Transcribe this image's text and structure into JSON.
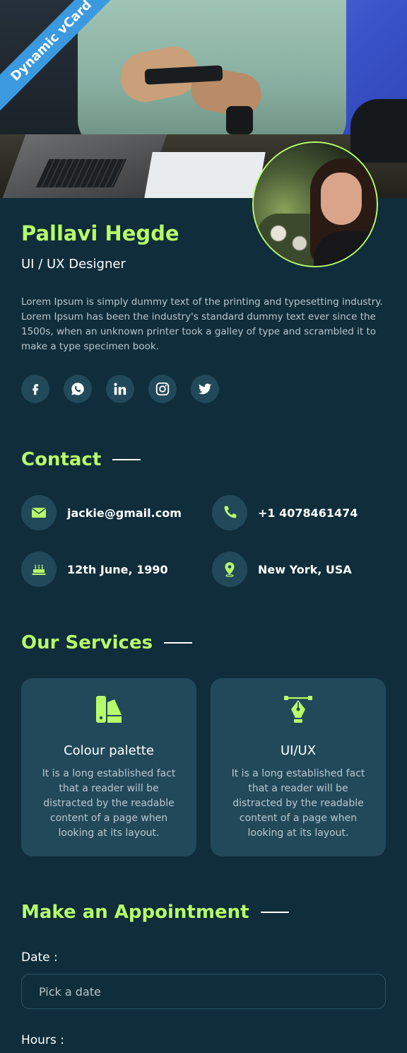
{
  "ribbon": {
    "label": "Dynamic vCard"
  },
  "profile": {
    "name": "Pallavi Hegde",
    "role": "UI / UX Designer",
    "about": "Lorem Ipsum is simply dummy text of the printing and typesetting industry. Lorem Ipsum has been the industry's standard dummy text ever since the 1500s, when an unknown printer took a galley of type and scrambled it to make a type specimen book."
  },
  "socials": [
    {
      "icon": "facebook-icon"
    },
    {
      "icon": "whatsapp-icon"
    },
    {
      "icon": "linkedin-icon"
    },
    {
      "icon": "instagram-icon"
    },
    {
      "icon": "twitter-icon"
    }
  ],
  "contact": {
    "title": "Contact",
    "email": "jackie@gmail.com",
    "phone": "+1 4078461474",
    "birthday": "12th June, 1990",
    "location": "New York, USA"
  },
  "services": {
    "title": "Our Services",
    "items": [
      {
        "icon": "colour-palette-icon",
        "title": "Colour palette",
        "description": "It is a long established fact that a reader will be distracted by the readable content of a page when looking at its layout."
      },
      {
        "icon": "pen-tool-icon",
        "title": "UI/UX",
        "description": "It is a long established fact that a reader will be distracted by the readable content of a page when looking at its layout."
      }
    ]
  },
  "appointment": {
    "title": "Make an Appointment",
    "date_label": "Date :",
    "date_placeholder": "Pick a date",
    "hours_label": "Hours :"
  },
  "colors": {
    "accent": "#b7fb6a",
    "background": "#0f2d3a",
    "card": "#22495a",
    "ribbon": "#3b99e0"
  }
}
